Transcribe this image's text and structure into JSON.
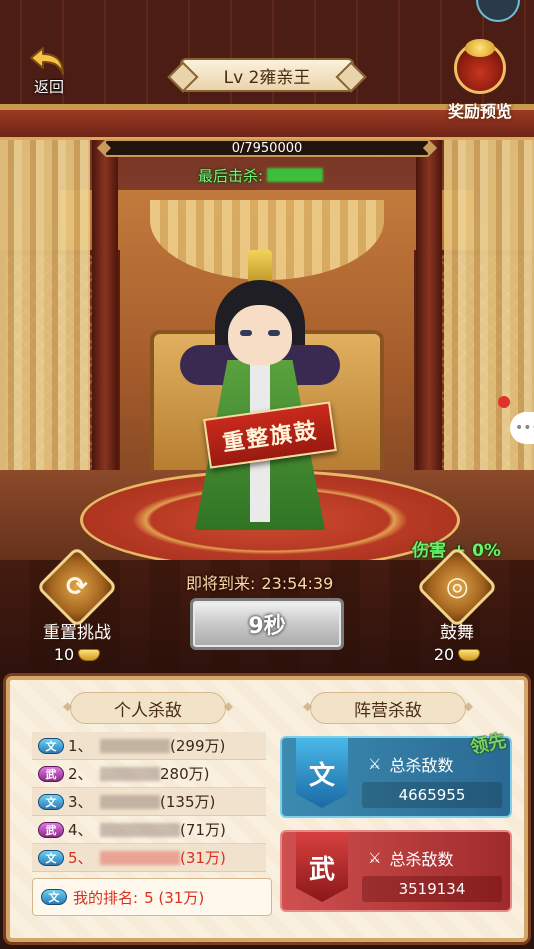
{
  "header": {
    "back_label": "返回",
    "boss_title": "Lv 2雍亲王",
    "reward_preview_label": "奖励预览"
  },
  "boss": {
    "hp_text": "0/7950000",
    "hp_fraction": 0,
    "last_kill_label": "最后击杀:",
    "banner_text": "重整旗鼓"
  },
  "battle": {
    "damage_bonus": "伤害 + 0%",
    "coming_label": "即将到来:",
    "coming_time": "23:54:39",
    "timer_button": "9秒"
  },
  "actions": {
    "reset": {
      "label": "重置挑战",
      "cost": "10",
      "icon": "refresh-icon"
    },
    "drum": {
      "label": "鼓舞",
      "cost": "20",
      "icon": "drum-icon"
    }
  },
  "panel": {
    "personal_tab": "个人杀敌",
    "faction_tab": "阵营杀敌",
    "ranks": [
      {
        "tag": "文",
        "faction": "wen",
        "no": "1、",
        "kills": "(299万)"
      },
      {
        "tag": "武",
        "faction": "wu",
        "no": "2、",
        "kills": "280万)"
      },
      {
        "tag": "文",
        "faction": "wen",
        "no": "3、",
        "kills": "(135万)"
      },
      {
        "tag": "武",
        "faction": "wu",
        "no": "4、",
        "kills": "(71万)"
      },
      {
        "tag": "文",
        "faction": "wen",
        "no": "5、",
        "kills": "(31万)"
      }
    ],
    "my_rank": {
      "tag": "文",
      "label": "我的排名:",
      "value": "5 (31万)"
    },
    "factions": [
      {
        "badge": "文",
        "stat_label": "总杀敌数",
        "value": "4665955"
      },
      {
        "badge": "武",
        "stat_label": "总杀敌数",
        "value": "3519134"
      }
    ],
    "leading_label": "领先"
  },
  "colors": {
    "wen_accent": "#2a7ab8",
    "wu_accent": "#a02a2a",
    "highlight_red": "#d83020",
    "success_green": "#6af06a"
  }
}
